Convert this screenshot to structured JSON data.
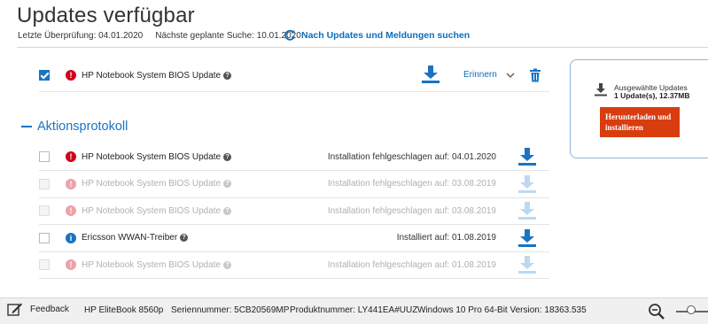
{
  "header": {
    "title": "Updates verfügbar",
    "last_check": "Letzte Überprüfung: 04.01.2020",
    "next_search": "Nächste geplante Suche: 10.01.2020",
    "check_link": "Nach Updates und Meldungen suchen"
  },
  "available": {
    "item": {
      "name": "HP Notebook System BIOS Update",
      "checked": true,
      "status_icon": "alert-icon",
      "remind_label": "Erinnern"
    }
  },
  "selected_panel": {
    "label": "Ausgewählte Updates",
    "summary": "1 Update(s), 12.37MB",
    "button_line1": "Herunterladen und",
    "button_line2": "installieren"
  },
  "log": {
    "title": "Aktionsprotokoll",
    "rows": [
      {
        "name": "HP Notebook System BIOS Update",
        "status": "Installation fehlgeschlagen auf: 04.01.2020",
        "icon": "alert",
        "faded": false
      },
      {
        "name": "HP Notebook System BIOS Update",
        "status": "Installation fehlgeschlagen auf: 03.08.2019",
        "icon": "alert",
        "faded": true
      },
      {
        "name": "HP Notebook System BIOS Update",
        "status": "Installation fehlgeschlagen auf: 03.08.2019",
        "icon": "alert",
        "faded": true
      },
      {
        "name": "Ericsson WWAN-Treiber",
        "status": "Installiert auf: 01.08.2019",
        "icon": "info",
        "faded": false
      },
      {
        "name": "HP Notebook System BIOS Update",
        "status": "Installation fehlgeschlagen auf: 01.08.2019",
        "icon": "alert",
        "faded": true
      }
    ]
  },
  "footer": {
    "feedback": "Feedback",
    "model": "HP EliteBook 8560p",
    "serial": "Seriennummer: 5CB20569MP",
    "product": "Produktnummer: LY441EA#UUZ",
    "os": "Windows 10 Pro 64-Bit Version: 18363.535"
  },
  "colors": {
    "accent": "#1a73c2",
    "link": "#0a6ebd",
    "alert": "#d0021b",
    "alert_faded": "#f0a0a6",
    "info": "#1a73c2",
    "download_faded": "#bcd9f1",
    "button": "#d83c0f"
  }
}
